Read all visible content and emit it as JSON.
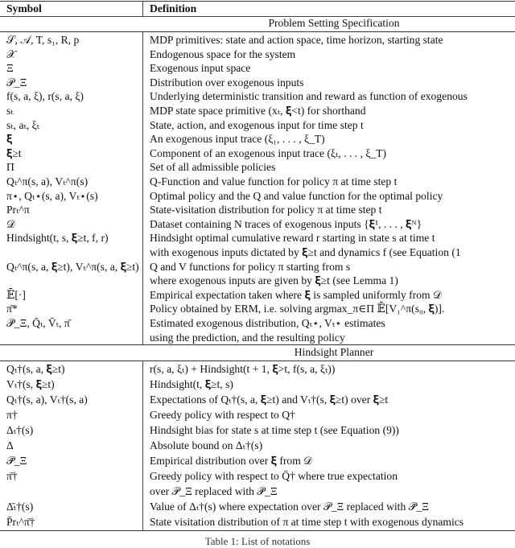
{
  "table": {
    "headers": {
      "symbol": "Symbol",
      "definition": "Definition"
    },
    "sections": [
      {
        "title": "Problem Setting Specification",
        "rows": [
          {
            "symbol": "𝒮, 𝒜, T, s₁, R, p",
            "definition": "MDP primitives: state and action space, time horizon, starting state"
          },
          {
            "symbol": "𝒳",
            "definition": "Endogenous space for the system"
          },
          {
            "symbol": "Ξ",
            "definition": "Exogenous input space"
          },
          {
            "symbol": "𝒫_Ξ",
            "definition": "Distribution over exogenous inputs"
          },
          {
            "symbol": "f(s, a, ξ), r(s, a, ξ)",
            "definition": "Underlying deterministic transition and reward as function of exogenous"
          },
          {
            "symbol": "sₜ",
            "definition": "MDP state space primitive (xₜ, 𝛏<t) for shorthand"
          },
          {
            "symbol": "sₜ, aₜ, ξₜ",
            "definition": "State, action, and exogenous input for time step t"
          },
          {
            "symbol": "𝛏",
            "definition": "An exogenous input trace (ξ₁, . . . , ξ_T)"
          },
          {
            "symbol": "𝛏≥t",
            "definition": "Component of an exogenous input trace (ξₜ, . . . , ξ_T)"
          },
          {
            "symbol": "Π",
            "definition": "Set of all admissible policies"
          },
          {
            "symbol": "Qₜ^π(s, a), Vₜ^π(s)",
            "definition": "Q-Function and value function for policy π at time step t"
          },
          {
            "symbol": "π⋆, Qₜ⋆(s, a), Vₜ⋆(s)",
            "definition": "Optimal policy and the Q and value function for the optimal policy"
          },
          {
            "symbol": "Prₜ^π",
            "definition": "State-visitation distribution for policy π at time step t"
          },
          {
            "symbol": "𝒟",
            "definition": "Dataset containing N traces of exogenous inputs {𝛏¹, . . . , 𝛏ᴺ}"
          },
          {
            "symbol": "Hindsight(t, s, 𝛏≥t, f, r)",
            "definition": "Hindsight optimal cumulative reward r starting in state s at time t"
          },
          {
            "symbol": "",
            "definition": "with exogenous inputs dictated by 𝛏≥t and dynamics f (see Equation (1"
          },
          {
            "symbol": "Qₜ^π(s, a, 𝛏≥t), Vₜ^π(s, a, 𝛏≥t)",
            "definition": "Q and V functions for policy π starting from s"
          },
          {
            "symbol": "",
            "definition": "where exogenous inputs are given by 𝛏≥t (see Lemma 1)"
          },
          {
            "symbol": "𝔼̄[·]",
            "definition": "Empirical expectation taken where 𝛏 is sampled uniformly from 𝒟"
          },
          {
            "symbol": "π̄*",
            "definition": "Policy obtained by ERM, i.e. solving argmax_π∈Π 𝔼̄[V₁^π(s₀, 𝛏)]."
          },
          {
            "symbol": "𝒫̄_Ξ, Q̄ₜ, V̄ₜ, π̄",
            "definition": "Estimated exogenous distribution, Qₜ⋆, Vₜ⋆ estimates"
          },
          {
            "symbol": "",
            "definition": "using the prediction, and the resulting policy"
          }
        ]
      },
      {
        "title": "Hindsight Planner",
        "rows": [
          {
            "symbol": "Qₜ†(s, a, 𝛏≥t)",
            "definition": "r(s, a, ξₜ) + Hindsight(t + 1, 𝛏>t, f(s, a, ξₜ))"
          },
          {
            "symbol": "Vₜ†(s, 𝛏≥t)",
            "definition": "Hindsight(t, 𝛏≥t, s)"
          },
          {
            "symbol": "Qₜ†(s, a), Vₜ†(s, a)",
            "definition": "Expectations of Qₜ†(s, a, 𝛏≥t) and Vₜ†(s, 𝛏≥t) over 𝛏≥t"
          },
          {
            "symbol": "π†",
            "definition": "Greedy policy with respect to Q†"
          },
          {
            "symbol": "Δₜ†(s)",
            "definition": "Hindsight bias for state s at time step t (see Equation (9))"
          },
          {
            "symbol": "Δ",
            "definition": "Absolute bound on Δₜ†(s)"
          },
          {
            "symbol": "𝒫̄_Ξ",
            "definition": "Empirical distribution over 𝛏 from 𝒟"
          },
          {
            "symbol": "π̄†",
            "definition": "Greedy policy with respect to Q̄† where true expectation"
          },
          {
            "symbol": "",
            "definition": "over 𝒫_Ξ replaced with 𝒫̄_Ξ"
          },
          {
            "symbol": "Δ̄ₜ†(s)",
            "definition": "Value of Δₜ†(s) where expectation over 𝒫_Ξ replaced with 𝒫̄_Ξ"
          },
          {
            "symbol": "P̄rₜ^π̄†",
            "definition": "State visitation distribution of π at time step t with exogenous dynamics"
          }
        ]
      }
    ]
  },
  "caption": "Table 1: List of notations"
}
